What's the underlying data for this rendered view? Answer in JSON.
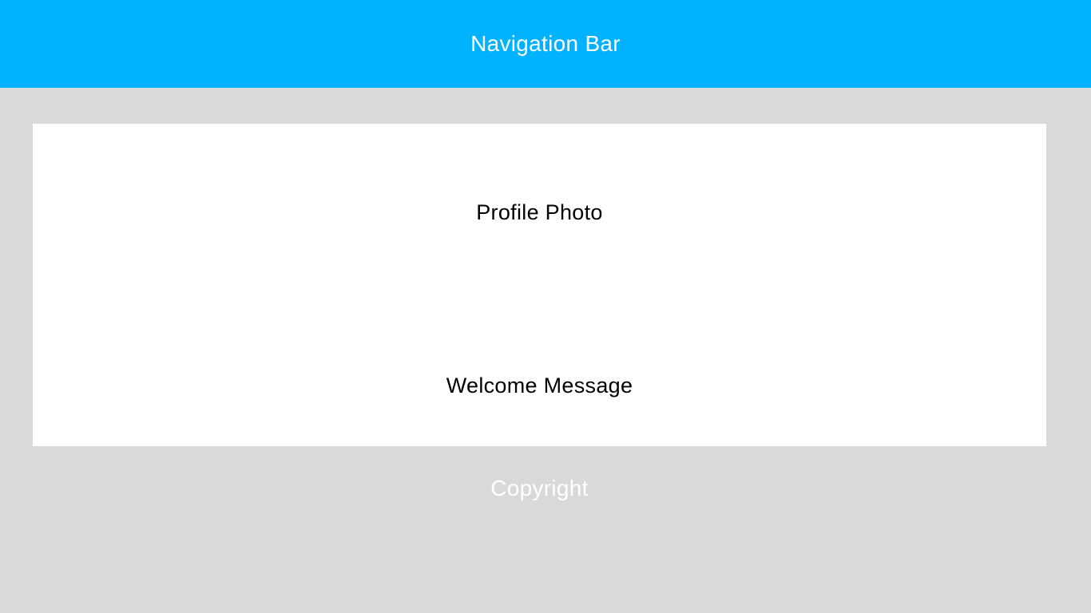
{
  "navbar": {
    "title": "Navigation Bar"
  },
  "card": {
    "profile_photo_label": "Profile Photo",
    "welcome_message_label": "Welcome Message"
  },
  "footer": {
    "copyright_label": "Copyright"
  },
  "colors": {
    "navbar_background": "#00b2ff",
    "page_background": "#d9d9d9",
    "card_background": "#ffffff",
    "navbar_text": "#ffffff",
    "card_text": "#000000",
    "footer_text": "#ffffff"
  }
}
